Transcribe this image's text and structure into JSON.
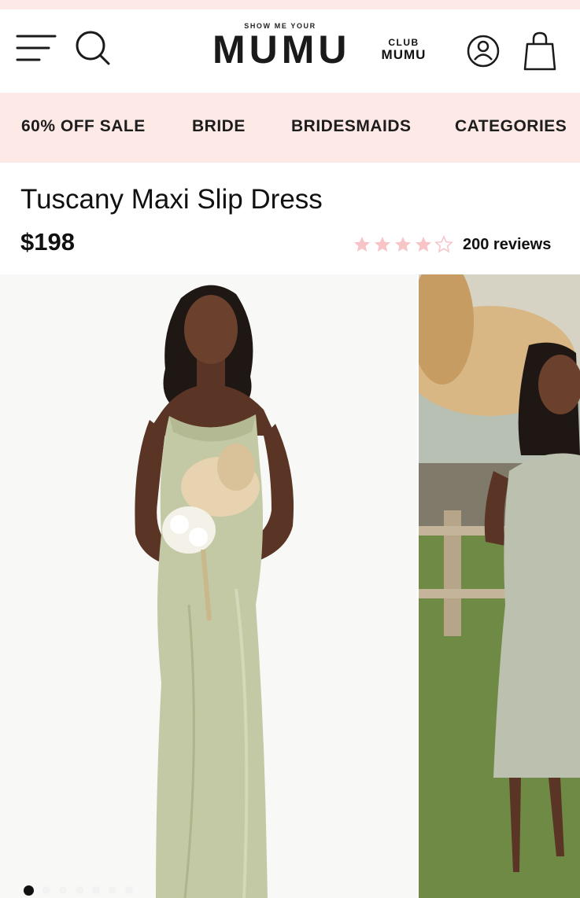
{
  "header": {
    "logo_small": "SHOW ME YOUR",
    "logo_big": "MUMU",
    "club_top": "CLUB",
    "club_bottom": "MUMU",
    "icons": [
      "menu-icon",
      "search-icon",
      "account-icon",
      "shopping-bag-icon"
    ]
  },
  "nav": {
    "items": [
      {
        "label": "60% OFF SALE"
      },
      {
        "label": "BRIDE"
      },
      {
        "label": "BRIDESMAIDS"
      },
      {
        "label": "CATEGORIES"
      }
    ]
  },
  "product": {
    "title": "Tuscany Maxi Slip Dress",
    "price": "$198",
    "rating_stars": 4,
    "rating_max": 5,
    "reviews": "200 reviews"
  },
  "gallery": {
    "image_count": 7,
    "active_index": 0
  },
  "colors": {
    "accent_pink": "#fde9e5",
    "star_pink": "#f7c4c8",
    "text": "#111111",
    "dress_sage": "#c3c9a4"
  }
}
